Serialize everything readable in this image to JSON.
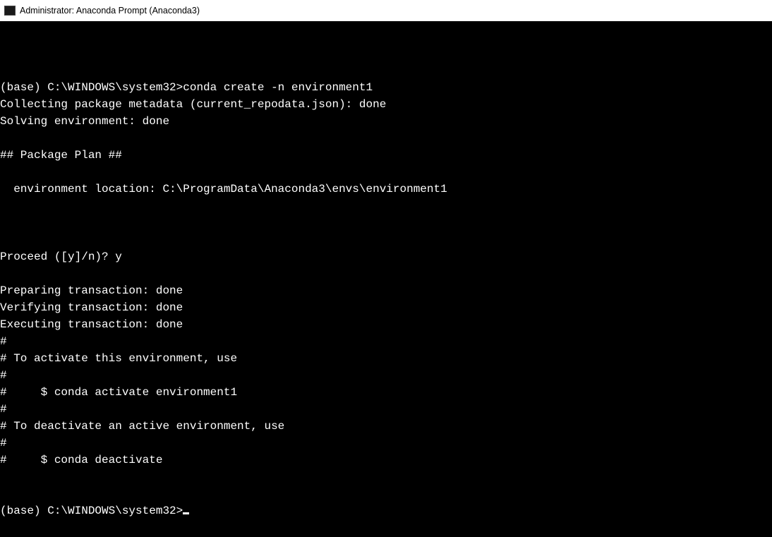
{
  "window": {
    "title": "Administrator: Anaconda Prompt (Anaconda3)",
    "icon_name": "terminal-icon"
  },
  "terminal": {
    "lines": [
      "",
      "(base) C:\\WINDOWS\\system32>conda create -n environment1",
      "Collecting package metadata (current_repodata.json): done",
      "Solving environment: done",
      "",
      "## Package Plan ##",
      "",
      "  environment location: C:\\ProgramData\\Anaconda3\\envs\\environment1",
      "",
      "",
      "",
      "Proceed ([y]/n)? y",
      "",
      "Preparing transaction: done",
      "Verifying transaction: done",
      "Executing transaction: done",
      "#",
      "# To activate this environment, use",
      "#",
      "#     $ conda activate environment1",
      "#",
      "# To deactivate an active environment, use",
      "#",
      "#     $ conda deactivate",
      "",
      "",
      "(base) C:\\WINDOWS\\system32>"
    ],
    "prompt_prefix": "(base) C:\\WINDOWS\\system32>",
    "last_command": "conda create -n environment1",
    "user_input": "y"
  }
}
